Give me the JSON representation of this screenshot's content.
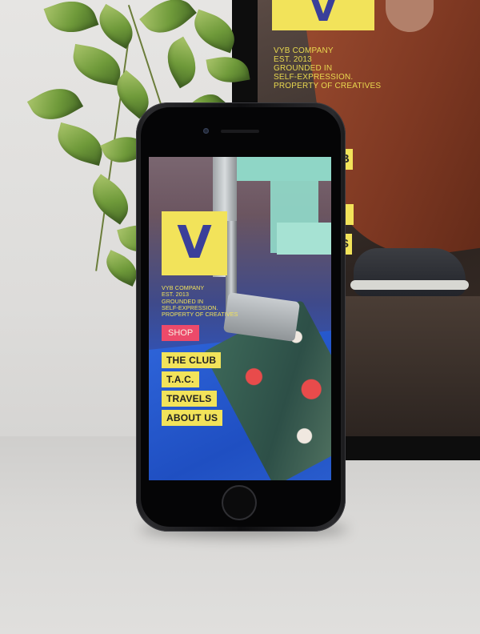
{
  "brand": {
    "logo_letter": "V",
    "tagline_lines": [
      "VYB COMPANY",
      "EST. 2013",
      "GROUNDED IN",
      "SELF-EXPRESSION.",
      "PROPERTY OF CREATIVES"
    ],
    "monitor_tagline_lines": [
      "VYB COMPANY",
      "EST. 2013",
      "GROUNDED IN",
      "SELF-EXPRESSION.",
      "PROPERTY OF CREATIVES"
    ]
  },
  "nav": {
    "shop_label": "SHOP",
    "items": [
      "THE CLUB",
      "T.A.C.",
      "TRAVELS",
      "ABOUT US"
    ]
  },
  "monitor_nav": {
    "items": [
      "B",
      "",
      "S"
    ]
  },
  "colors": {
    "accent_yellow": "#f2e35a",
    "logo_blue": "#3a3f9a",
    "shop_pink": "#ec4a6a"
  },
  "icons": {
    "home": "home-button-icon",
    "camera": "front-camera-icon"
  }
}
